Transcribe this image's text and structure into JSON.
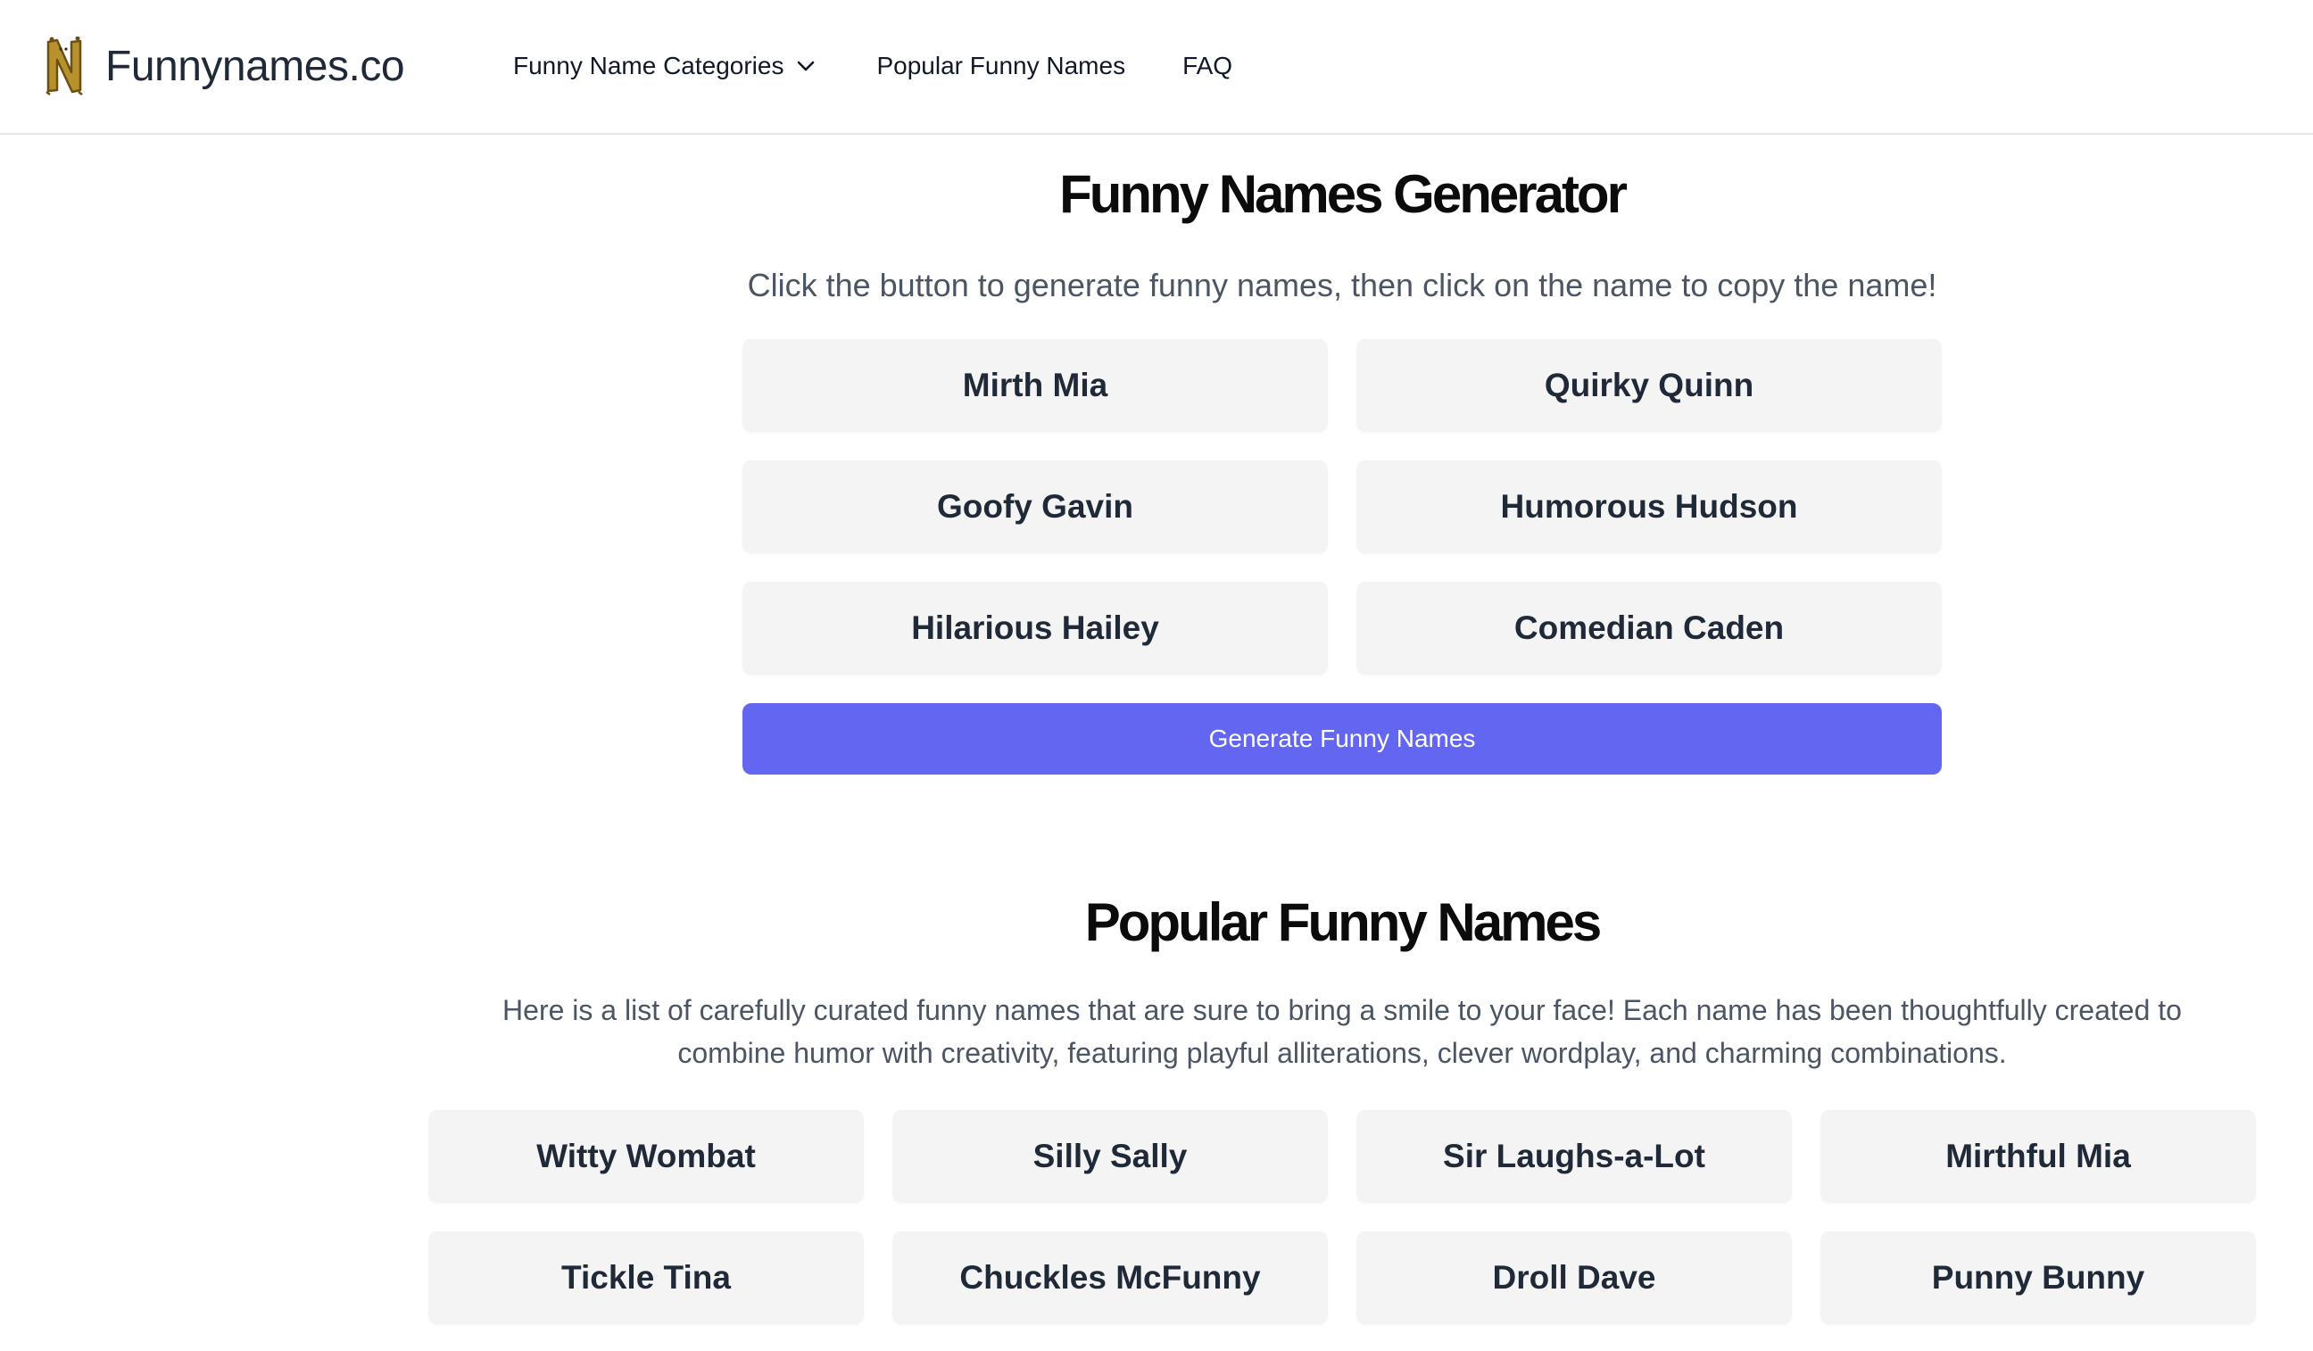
{
  "header": {
    "logo_text": "Funnynames.co",
    "nav": {
      "categories_label": "Funny Name Categories",
      "popular_label": "Popular Funny Names",
      "faq_label": "FAQ"
    }
  },
  "generator": {
    "title": "Funny Names Generator",
    "subtitle": "Click the button to generate funny names, then click on the name to copy the name!",
    "names": [
      "Mirth Mia",
      "Quirky Quinn",
      "Goofy Gavin",
      "Humorous Hudson",
      "Hilarious Hailey",
      "Comedian Caden"
    ],
    "button_label": "Generate Funny Names"
  },
  "popular": {
    "title": "Popular Funny Names",
    "description": "Here is a list of carefully curated funny names that are sure to bring a smile to your face! Each name has been thoughtfully created to combine humor with creativity, featuring playful alliterations, clever wordplay, and charming combinations.",
    "names": [
      "Witty Wombat",
      "Silly Sally",
      "Sir Laughs-a-Lot",
      "Mirthful Mia",
      "Tickle Tina",
      "Chuckles McFunny",
      "Droll Dave",
      "Punny Bunny"
    ]
  },
  "colors": {
    "accent": "#6366f1",
    "card_bg": "#f4f4f5",
    "text": "#1f2937",
    "muted": "#4b5563"
  },
  "icons": {
    "logo": "letter-n-logo-icon",
    "dropdown": "chevron-down-icon"
  }
}
